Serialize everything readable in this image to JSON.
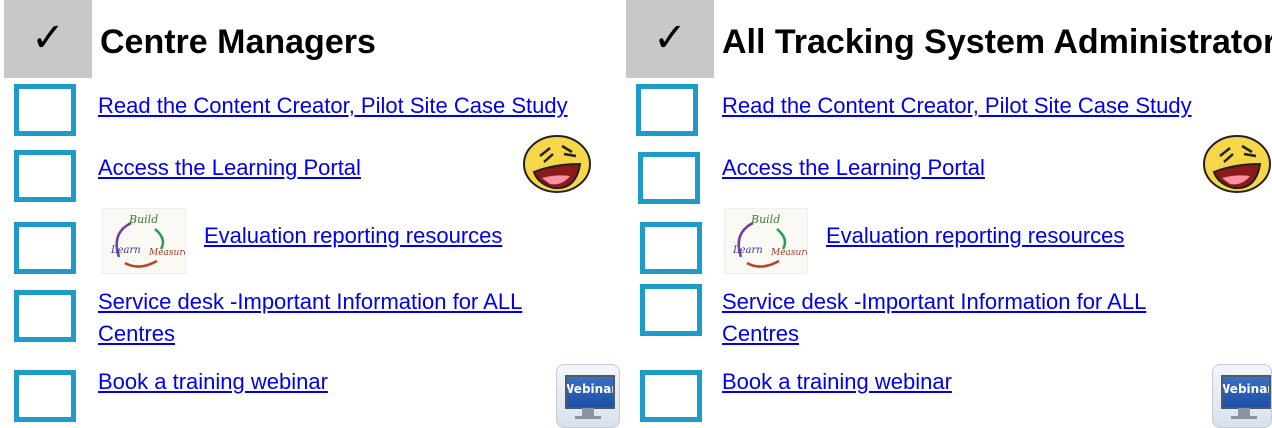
{
  "panels": [
    {
      "checkmark": "✓",
      "title": "Centre Managers",
      "items": [
        {
          "label": "Read the Content Creator, Pilot Site Case Study"
        },
        {
          "label": "Access the Learning Portal"
        },
        {
          "label": "Evaluation reporting resources"
        },
        {
          "label": "Service desk -Important Information for ALL Centres"
        },
        {
          "label": "Book a training webinar"
        }
      ],
      "eval_image_words": {
        "build": "Build",
        "learn": "Learn",
        "measure": "Measure"
      },
      "webinar_icon_text": "Webinar"
    },
    {
      "checkmark": "✓",
      "title": "All Tracking System Administrators",
      "items": [
        {
          "label": "Read the Content Creator, Pilot Site Case Study"
        },
        {
          "label": "Access the Learning Portal"
        },
        {
          "label": "Evaluation reporting resources"
        },
        {
          "label": "Service desk -Important Information for ALL Centres"
        },
        {
          "label": "Book a training webinar"
        }
      ],
      "eval_image_words": {
        "build": "Build",
        "learn": "Learn",
        "measure": "Measure"
      },
      "webinar_icon_text": "Webinar"
    }
  ],
  "colors": {
    "checkbox_border": "#1e9bc8",
    "header_bg": "#c8c8c8",
    "link": "#0000ee"
  },
  "icons": [
    "checkmark-icon",
    "checkbox-icon",
    "laughing-emoji-icon",
    "build-measure-learn-image",
    "webinar-monitor-icon"
  ]
}
